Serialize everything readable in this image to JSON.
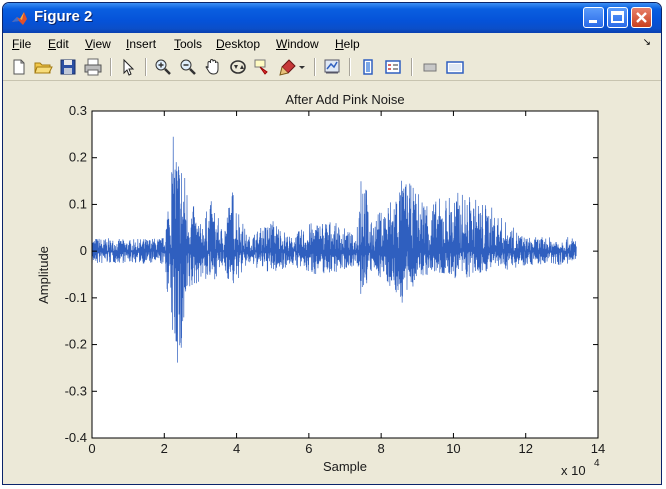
{
  "window": {
    "title": "Figure 2"
  },
  "menu": [
    {
      "label": "File",
      "key": "F",
      "rest": "ile"
    },
    {
      "label": "Edit",
      "key": "E",
      "rest": "dit"
    },
    {
      "label": "View",
      "key": "V",
      "rest": "iew"
    },
    {
      "label": "Insert",
      "key": "I",
      "rest": "nsert"
    },
    {
      "label": "Tools",
      "key": "T",
      "rest": "ools"
    },
    {
      "label": "Desktop",
      "key": "D",
      "rest": "esktop"
    },
    {
      "label": "Window",
      "key": "W",
      "rest": "indow"
    },
    {
      "label": "Help",
      "key": "H",
      "rest": "elp"
    }
  ],
  "toolbar": {
    "icons": [
      "new-figure-icon",
      "open-file-icon",
      "save-icon",
      "print-icon",
      "edit-plot-arrow-icon",
      "zoom-in-icon",
      "zoom-out-icon",
      "pan-hand-icon",
      "rotate-3d-icon",
      "data-cursor-icon",
      "brush-icon",
      "link-plot-icon",
      "colorbar-icon",
      "legend-icon",
      "hide-plot-tools-icon",
      "show-plot-tools-icon"
    ]
  },
  "chart_data": {
    "type": "line",
    "title": "After Add Pink Noise",
    "xlabel": "Sample",
    "ylabel": "Amplitude",
    "x_multiplier_label": "x 10",
    "x_multiplier_exponent": "4",
    "xlim": [
      0,
      14
    ],
    "ylim": [
      -0.4,
      0.3
    ],
    "xticks": [
      "0",
      "2",
      "4",
      "6",
      "8",
      "10",
      "12",
      "14"
    ],
    "yticks": [
      "0.3",
      "0.2",
      "0.1",
      "0",
      "-0.1",
      "-0.2",
      "-0.3",
      "-0.4"
    ],
    "series": [
      {
        "color": "#2f5fbf",
        "signal_range_x": [
          0,
          13.4
        ],
        "envelope": [
          {
            "x": 0.0,
            "upper": 0.03,
            "lower": -0.03
          },
          {
            "x": 1.0,
            "upper": 0.025,
            "lower": -0.025
          },
          {
            "x": 2.0,
            "upper": 0.03,
            "lower": -0.03
          },
          {
            "x": 2.25,
            "upper": 0.25,
            "lower": -0.21
          },
          {
            "x": 2.45,
            "upper": 0.22,
            "lower": -0.28
          },
          {
            "x": 2.7,
            "upper": 0.12,
            "lower": -0.1
          },
          {
            "x": 3.0,
            "upper": 0.06,
            "lower": -0.06
          },
          {
            "x": 3.3,
            "upper": 0.11,
            "lower": -0.07
          },
          {
            "x": 3.6,
            "upper": 0.05,
            "lower": -0.04
          },
          {
            "x": 3.9,
            "upper": 0.14,
            "lower": -0.08
          },
          {
            "x": 4.3,
            "upper": 0.03,
            "lower": -0.03
          },
          {
            "x": 5.0,
            "upper": 0.07,
            "lower": -0.05
          },
          {
            "x": 5.5,
            "upper": 0.03,
            "lower": -0.03
          },
          {
            "x": 6.0,
            "upper": 0.06,
            "lower": -0.05
          },
          {
            "x": 6.5,
            "upper": 0.07,
            "lower": -0.05
          },
          {
            "x": 7.0,
            "upper": 0.05,
            "lower": -0.04
          },
          {
            "x": 7.3,
            "upper": 0.03,
            "lower": -0.03
          },
          {
            "x": 7.45,
            "upper": 0.25,
            "lower": -0.11
          },
          {
            "x": 7.7,
            "upper": 0.06,
            "lower": -0.05
          },
          {
            "x": 8.1,
            "upper": 0.1,
            "lower": -0.06
          },
          {
            "x": 8.6,
            "upper": 0.16,
            "lower": -0.12
          },
          {
            "x": 9.0,
            "upper": 0.13,
            "lower": -0.06
          },
          {
            "x": 9.5,
            "upper": 0.11,
            "lower": -0.05
          },
          {
            "x": 10.0,
            "upper": 0.13,
            "lower": -0.06
          },
          {
            "x": 10.5,
            "upper": 0.12,
            "lower": -0.06
          },
          {
            "x": 11.0,
            "upper": 0.1,
            "lower": -0.04
          },
          {
            "x": 11.5,
            "upper": 0.06,
            "lower": -0.04
          },
          {
            "x": 12.0,
            "upper": 0.03,
            "lower": -0.03
          },
          {
            "x": 12.6,
            "upper": 0.03,
            "lower": -0.03
          },
          {
            "x": 13.4,
            "upper": 0.03,
            "lower": -0.03
          }
        ]
      }
    ],
    "grid": false,
    "box": true
  }
}
